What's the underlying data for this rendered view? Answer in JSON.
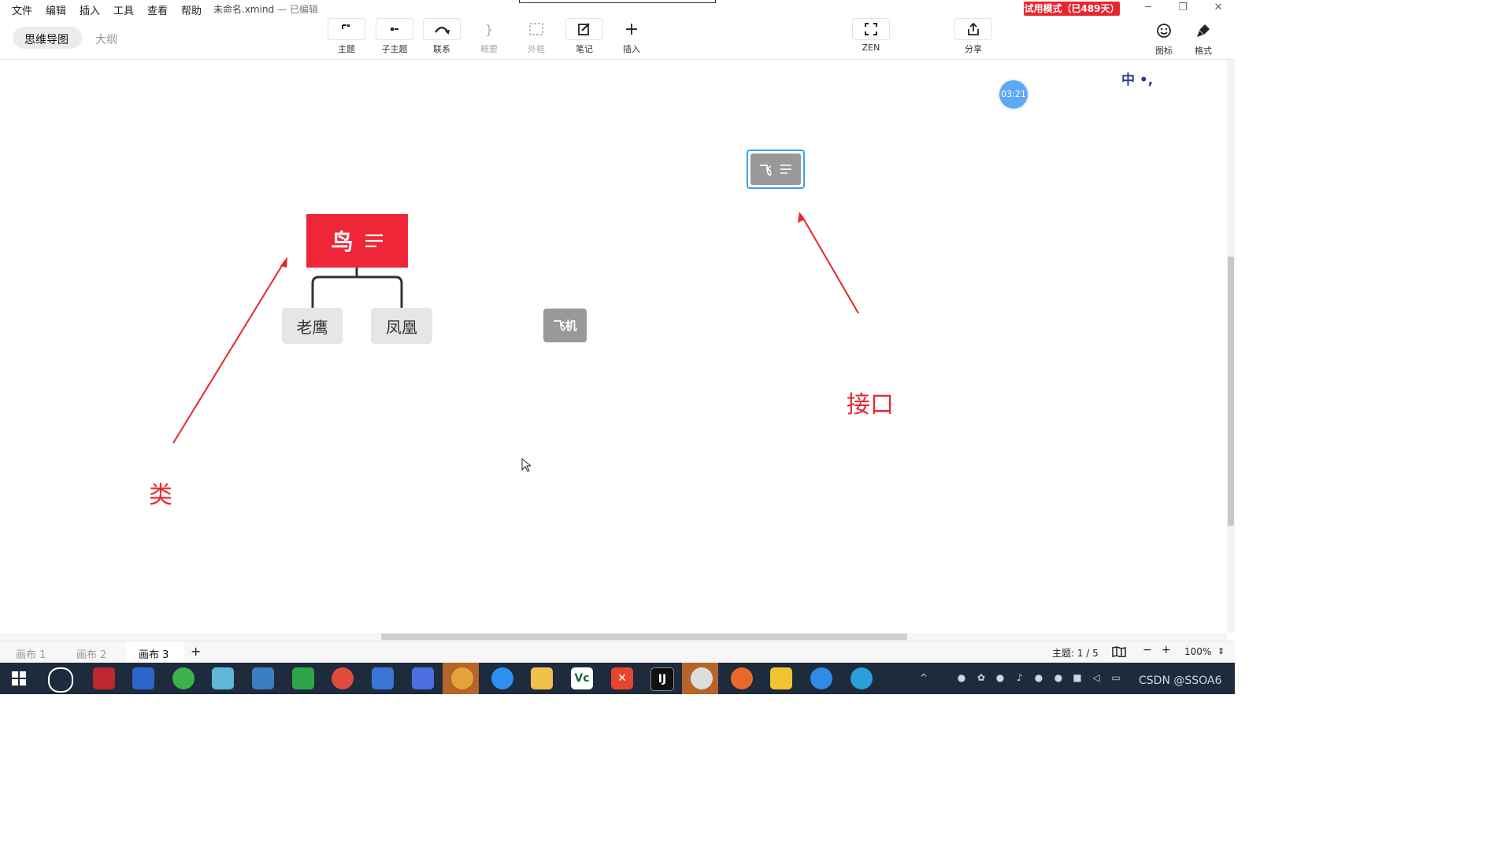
{
  "menu": {
    "items": [
      "文件",
      "编辑",
      "插入",
      "工具",
      "查看",
      "帮助"
    ],
    "doc_title": "未命名.xmind",
    "doc_status": "— 已编辑",
    "trial_badge": "试用模式（已489天）"
  },
  "view_tabs": {
    "mindmap": "思维导图",
    "outline": "大纲"
  },
  "toolbar": {
    "topic": "主题",
    "subtopic": "子主题",
    "relationship": "联系",
    "summary": "概要",
    "boundary": "外框",
    "notes": "笔记",
    "insert": "插入",
    "zen": "ZEN",
    "share": "分享",
    "icons": "图标",
    "format": "格式"
  },
  "canvas": {
    "central_topic": "鸟",
    "subtopics": [
      "老鹰",
      "凤凰"
    ],
    "floating_topic": "飞机",
    "selected_topic": "飞",
    "annotation_class": "类",
    "annotation_interface": "接口",
    "timer": "03:21",
    "ime_indicator": "中 •,"
  },
  "sheets": {
    "tabs": [
      "画布 1",
      "画布 2",
      "画布 3"
    ],
    "active_index": 2,
    "add_label": "+",
    "topic_count": "主题: 1 / 5",
    "zoom": "100%"
  },
  "taskbar": {
    "watermark": "CSDN @SSOA6"
  },
  "colors": {
    "central_topic": "#ef2637",
    "annotation": "#e8262e",
    "selection": "#3aa0f5",
    "taskbar": "#1e2b3c"
  }
}
